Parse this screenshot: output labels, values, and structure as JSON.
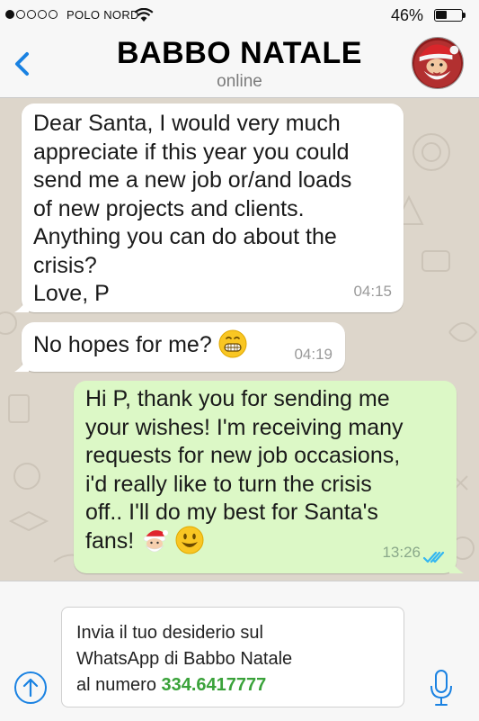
{
  "status_bar": {
    "carrier": "POLO NORD",
    "battery_percent": "46%",
    "battery_level": 0.46,
    "signal_bars_filled": 1,
    "signal_bars_total": 5
  },
  "header": {
    "contact_name": "BABBO NATALE",
    "contact_status": "online",
    "back_icon": "chevron-left-icon",
    "avatar": "santa-avatar"
  },
  "messages": [
    {
      "direction": "incoming",
      "text": "Dear Santa, I would very much\nappreciate if this year you could\nsend me a new job or/and loads\nof new projects and clients.\nAnything you can do about the\ncrisis?\nLove, P",
      "time": "04:15"
    },
    {
      "direction": "incoming",
      "text": "No hopes for me?",
      "emoji": [
        "grimacing-face-emoji"
      ],
      "time": "04:19"
    },
    {
      "direction": "outgoing",
      "text": "Hi P, thank you for sending me\nyour wishes! I'm receiving many\nrequests for new job occasions,\ni'd really like to turn the crisis\noff.. I'll do my best for Santa's\nfans!",
      "emoji": [
        "santa-emoji",
        "smiling-face-emoji"
      ],
      "time": "13:26",
      "read_receipt": "double-check-icon"
    }
  ],
  "input": {
    "line1": "Invia il tuo desiderio sul",
    "line2": "WhatsApp di Babbo Natale",
    "line3_prefix": "al numero ",
    "phone_number": "334.6417777",
    "attach_icon": "arrow-up-circle-icon",
    "mic_icon": "microphone-icon"
  },
  "colors": {
    "accent": "#1a82e2",
    "incoming_bubble": "#ffffff",
    "outgoing_bubble": "#dcf8c6",
    "read_tick": "#34b7f1",
    "phone_number": "#3aa23a",
    "chat_background": "#ddd6cb"
  }
}
